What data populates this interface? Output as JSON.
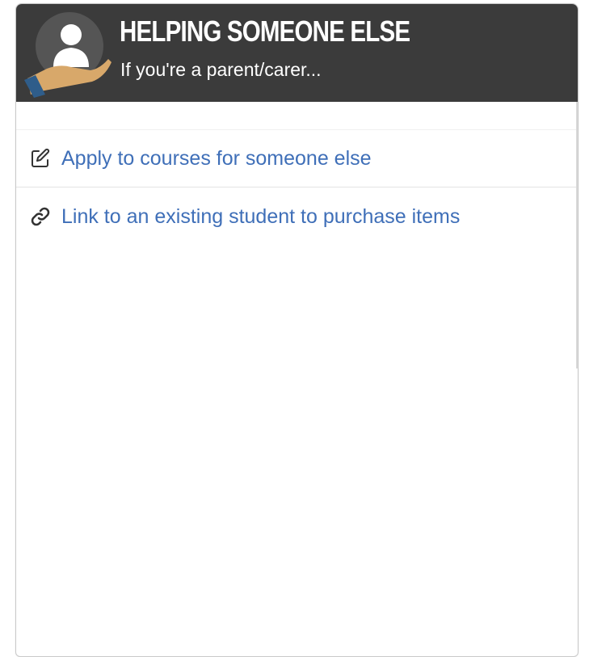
{
  "panel": {
    "title": "HELPING SOMEONE ELSE",
    "subtitle": "If you're a parent/carer...",
    "header_color": "#3b3b3b",
    "avatar_icon": "person-in-hand-icon"
  },
  "menu": {
    "items": [
      {
        "label": "Apply to courses for someone else",
        "icon": "edit-icon"
      },
      {
        "label": "Link to an existing student to purchase items",
        "icon": "link-icon"
      }
    ],
    "link_color": "#3f6fb8"
  }
}
